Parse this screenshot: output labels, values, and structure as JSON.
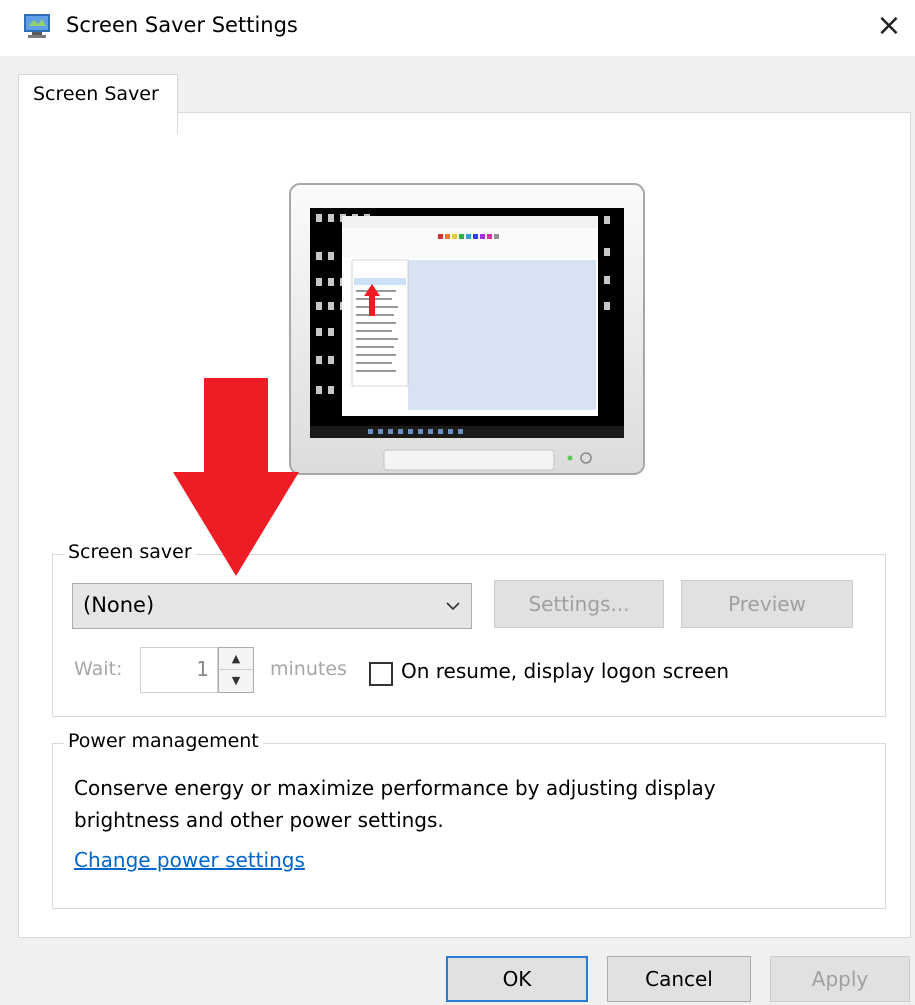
{
  "window": {
    "title": "Screen Saver Settings",
    "close_glyph": "×",
    "icon": "screen-saver-app-icon"
  },
  "tabs": [
    {
      "label": "Screen Saver",
      "selected": true
    }
  ],
  "screen_saver": {
    "group_label": "Screen saver",
    "selected": "(None)",
    "settings_button": "Settings...",
    "preview_button": "Preview",
    "wait_label": "Wait:",
    "wait_value": "1",
    "minutes_label": "minutes",
    "resume_checkbox_label": "On resume, display logon screen",
    "resume_checked": false
  },
  "power": {
    "group_label": "Power management",
    "description": "Conserve energy or maximize performance by adjusting display brightness and other power settings.",
    "link": "Change power settings"
  },
  "buttons": {
    "ok": "OK",
    "cancel": "Cancel",
    "apply": "Apply"
  },
  "annotation": {
    "arrow_color": "#ee1c25",
    "arrow_direction": "down"
  },
  "colors": {
    "link": "#0066cc",
    "focus_border": "#2b7bd6"
  }
}
